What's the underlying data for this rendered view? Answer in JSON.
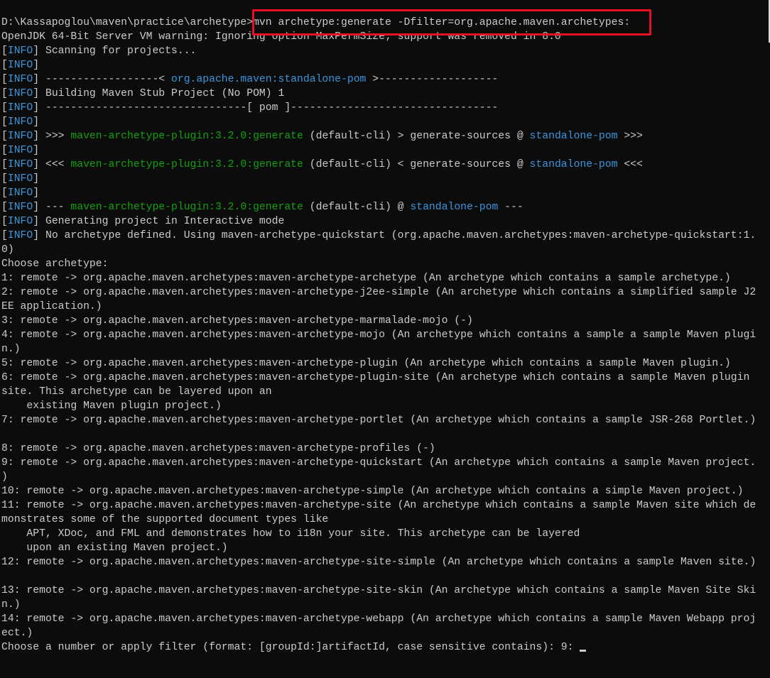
{
  "colors": {
    "background": "#0c0c0c",
    "text": "#cccccc",
    "info": "#3a96dd",
    "plugin": "#13a10e",
    "highlight": "#e81123"
  },
  "lines": [
    [
      [
        "D:\\Kassapoglou\\maven\\practice\\archetype>",
        "n"
      ],
      [
        "mvn archetype:generate -Dfilter=org.apache.maven.archetypes:",
        "n"
      ]
    ],
    [
      [
        "OpenJDK 64-Bit Server VM warning: Ignoring option MaxPermSize; support was removed in 8.0",
        "n"
      ]
    ],
    [
      [
        "[",
        "n"
      ],
      [
        "INFO",
        "b"
      ],
      [
        "] Scanning for projects...",
        "n"
      ]
    ],
    [
      [
        "[",
        "n"
      ],
      [
        "INFO",
        "b"
      ],
      [
        "]",
        "n"
      ]
    ],
    [
      [
        "[",
        "n"
      ],
      [
        "INFO",
        "b"
      ],
      [
        "] ------------------< ",
        "n"
      ],
      [
        "org.apache.maven:standalone-pom",
        "b"
      ],
      [
        " >-------------------",
        "n"
      ]
    ],
    [
      [
        "[",
        "n"
      ],
      [
        "INFO",
        "b"
      ],
      [
        "] Building Maven Stub Project (No POM) 1",
        "n"
      ]
    ],
    [
      [
        "[",
        "n"
      ],
      [
        "INFO",
        "b"
      ],
      [
        "] --------------------------------[ pom ]---------------------------------",
        "n"
      ]
    ],
    [
      [
        "[",
        "n"
      ],
      [
        "INFO",
        "b"
      ],
      [
        "]",
        "n"
      ]
    ],
    [
      [
        "[",
        "n"
      ],
      [
        "INFO",
        "b"
      ],
      [
        "] >>> ",
        "n"
      ],
      [
        "maven-archetype-plugin:3.2.0:generate",
        "g"
      ],
      [
        " (default-cli) > generate-sources @ ",
        "n"
      ],
      [
        "standalone-pom",
        "b"
      ],
      [
        " >>>",
        "n"
      ]
    ],
    [
      [
        "[",
        "n"
      ],
      [
        "INFO",
        "b"
      ],
      [
        "]",
        "n"
      ]
    ],
    [
      [
        "[",
        "n"
      ],
      [
        "INFO",
        "b"
      ],
      [
        "] <<< ",
        "n"
      ],
      [
        "maven-archetype-plugin:3.2.0:generate",
        "g"
      ],
      [
        " (default-cli) < generate-sources @ ",
        "n"
      ],
      [
        "standalone-pom",
        "b"
      ],
      [
        " <<<",
        "n"
      ]
    ],
    [
      [
        "[",
        "n"
      ],
      [
        "INFO",
        "b"
      ],
      [
        "]",
        "n"
      ]
    ],
    [
      [
        "[",
        "n"
      ],
      [
        "INFO",
        "b"
      ],
      [
        "]",
        "n"
      ]
    ],
    [
      [
        "[",
        "n"
      ],
      [
        "INFO",
        "b"
      ],
      [
        "] --- ",
        "n"
      ],
      [
        "maven-archetype-plugin:3.2.0:generate",
        "g"
      ],
      [
        " (default-cli) @ ",
        "n"
      ],
      [
        "standalone-pom",
        "b"
      ],
      [
        " ---",
        "n"
      ]
    ],
    [
      [
        "[",
        "n"
      ],
      [
        "INFO",
        "b"
      ],
      [
        "] Generating project in Interactive mode",
        "n"
      ]
    ],
    [
      [
        "[",
        "n"
      ],
      [
        "INFO",
        "b"
      ],
      [
        "] No archetype defined. Using maven-archetype-quickstart (org.apache.maven.archetypes:maven-archetype-quickstart:1.",
        "n"
      ]
    ],
    [
      [
        "0)",
        "n"
      ]
    ],
    [
      [
        "Choose archetype:",
        "n"
      ]
    ],
    [
      [
        "1: remote -> org.apache.maven.archetypes:maven-archetype-archetype (An archetype which contains a sample archetype.)",
        "n"
      ]
    ],
    [
      [
        "2: remote -> org.apache.maven.archetypes:maven-archetype-j2ee-simple (An archetype which contains a simplified sample J2",
        "n"
      ]
    ],
    [
      [
        "EE application.)",
        "n"
      ]
    ],
    [
      [
        "3: remote -> org.apache.maven.archetypes:maven-archetype-marmalade-mojo (-)",
        "n"
      ]
    ],
    [
      [
        "4: remote -> org.apache.maven.archetypes:maven-archetype-mojo (An archetype which contains a sample a sample Maven plugi",
        "n"
      ]
    ],
    [
      [
        "n.)",
        "n"
      ]
    ],
    [
      [
        "5: remote -> org.apache.maven.archetypes:maven-archetype-plugin (An archetype which contains a sample Maven plugin.)",
        "n"
      ]
    ],
    [
      [
        "6: remote -> org.apache.maven.archetypes:maven-archetype-plugin-site (An archetype which contains a sample Maven plugin",
        "n"
      ]
    ],
    [
      [
        "site. This archetype can be layered upon an",
        "n"
      ]
    ],
    [
      [
        "    existing Maven plugin project.)",
        "n"
      ]
    ],
    [
      [
        "7: remote -> org.apache.maven.archetypes:maven-archetype-portlet (An archetype which contains a sample JSR-268 Portlet.)",
        "n"
      ]
    ],
    [],
    [
      [
        "8: remote -> org.apache.maven.archetypes:maven-archetype-profiles (-)",
        "n"
      ]
    ],
    [
      [
        "9: remote -> org.apache.maven.archetypes:maven-archetype-quickstart (An archetype which contains a sample Maven project.",
        "n"
      ]
    ],
    [
      [
        ")",
        "n"
      ]
    ],
    [
      [
        "10: remote -> org.apache.maven.archetypes:maven-archetype-simple (An archetype which contains a simple Maven project.)",
        "n"
      ]
    ],
    [
      [
        "11: remote -> org.apache.maven.archetypes:maven-archetype-site (An archetype which contains a sample Maven site which de",
        "n"
      ]
    ],
    [
      [
        "monstrates some of the supported document types like",
        "n"
      ]
    ],
    [
      [
        "    APT, XDoc, and FML and demonstrates how to i18n your site. This archetype can be layered",
        "n"
      ]
    ],
    [
      [
        "    upon an existing Maven project.)",
        "n"
      ]
    ],
    [
      [
        "12: remote -> org.apache.maven.archetypes:maven-archetype-site-simple (An archetype which contains a sample Maven site.)",
        "n"
      ]
    ],
    [],
    [
      [
        "13: remote -> org.apache.maven.archetypes:maven-archetype-site-skin (An archetype which contains a sample Maven Site Ski",
        "n"
      ]
    ],
    [
      [
        "n.)",
        "n"
      ]
    ],
    [
      [
        "14: remote -> org.apache.maven.archetypes:maven-archetype-webapp (An archetype which contains a sample Maven Webapp proj",
        "n"
      ]
    ],
    [
      [
        "ect.)",
        "n"
      ]
    ],
    [
      [
        "Choose a number or apply filter (format: [groupId:]artifactId, case sensitive contains): 9: ",
        "n"
      ]
    ]
  ]
}
